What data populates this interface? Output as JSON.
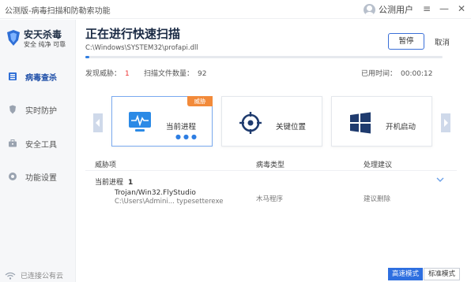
{
  "window": {
    "title": "公测版-病毒扫描和防勒索功能",
    "user_label": "公测用户",
    "controls": [
      "≡",
      "—",
      "✕"
    ]
  },
  "sidebar": {
    "brand_name": "安天杀毒",
    "brand_slogan": "安全 纯净 可靠",
    "items": [
      {
        "label": "病毒查杀",
        "icon": "scan-icon",
        "active": true
      },
      {
        "label": "实时防护",
        "icon": "shield-icon",
        "active": false
      },
      {
        "label": "安全工具",
        "icon": "toolbox-icon",
        "active": false
      },
      {
        "label": "功能设置",
        "icon": "gear-icon",
        "active": false
      }
    ],
    "connection_status": "已连接公有云"
  },
  "scan": {
    "title": "正在进行快速扫描",
    "current_path": "C:\\Windows\\SYSTEM32\\profapi.dll",
    "pause_label": "暂停",
    "cancel_label": "取消",
    "progress": 0.01,
    "threats_label": "发现威胁：",
    "threats_count": "1",
    "files_label": "扫描文件数量：",
    "files_count": "92",
    "elapsed_label": "已用时间：",
    "elapsed_value": "00:00:12"
  },
  "cards": [
    {
      "label": "当前进程",
      "icon": "process-monitor-icon",
      "badge": "威胁",
      "active": true
    },
    {
      "label": "关键位置",
      "icon": "target-icon",
      "active": false
    },
    {
      "label": "开机启动",
      "icon": "windows-icon",
      "active": false
    }
  ],
  "table": {
    "headers": [
      "威胁项",
      "病毒类型",
      "处理建议"
    ],
    "group_label": "当前进程",
    "group_count": "1",
    "rows": [
      {
        "name": "Trojan/Win32.FlyStudio",
        "path": "C:\\Users\\Admini... typesetterexe",
        "type": "木马程序",
        "action": "建议删除"
      }
    ]
  },
  "modes": {
    "fast": "高速模式",
    "standard": "标准模式"
  },
  "colors": {
    "accent": "#2e6fe0",
    "threat": "#e33333",
    "badge": "#f28a3a"
  }
}
